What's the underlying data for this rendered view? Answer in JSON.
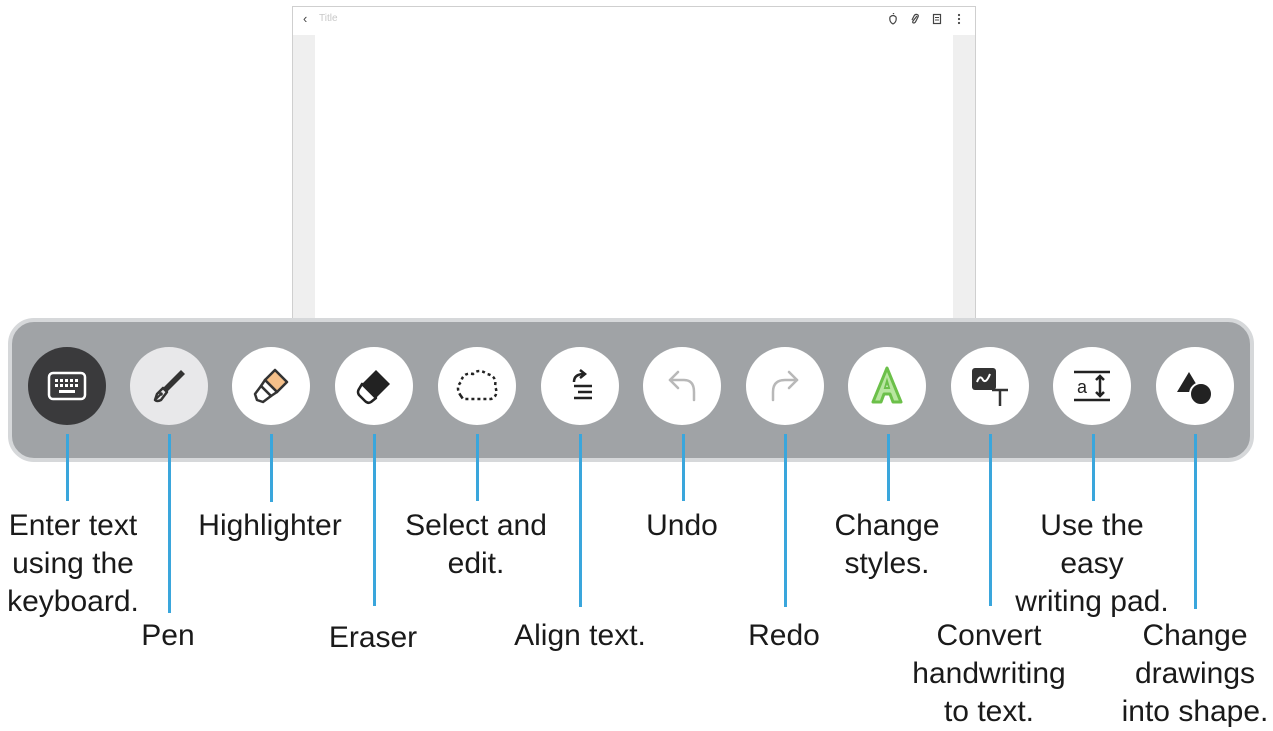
{
  "screen": {
    "title_placeholder": "Title",
    "back_glyph": "‹",
    "toolbar_icons": [
      "pdf-icon",
      "attach-icon",
      "file-icon",
      "more-icon"
    ]
  },
  "tools": [
    {
      "id": "keyboard",
      "icon": "keyboard-icon",
      "label": "Enter text\nusing the\nkeyboard."
    },
    {
      "id": "pen",
      "icon": "pen-icon",
      "label": "Pen"
    },
    {
      "id": "highlighter",
      "icon": "highlighter-icon",
      "label": "Highlighter"
    },
    {
      "id": "eraser",
      "icon": "eraser-icon",
      "label": "Eraser"
    },
    {
      "id": "select",
      "icon": "lasso-icon",
      "label": "Select and\nedit."
    },
    {
      "id": "align",
      "icon": "align-text-icon",
      "label": "Align text."
    },
    {
      "id": "undo",
      "icon": "undo-icon",
      "label": "Undo"
    },
    {
      "id": "redo",
      "icon": "redo-icon",
      "label": "Redo"
    },
    {
      "id": "styles",
      "icon": "style-icon",
      "label": "Change\nstyles."
    },
    {
      "id": "convert",
      "icon": "handwriting-to-text-icon",
      "label": "Convert\nhandwriting\nto text."
    },
    {
      "id": "writing-pad",
      "icon": "writing-pad-icon",
      "label": "Use the easy\nwriting pad."
    },
    {
      "id": "shapes",
      "icon": "shapes-icon",
      "label": "Change\ndrawings\ninto shape."
    }
  ],
  "colors": {
    "toolbar_bg": "#a0a3a6",
    "toolbar_border": "#d6d8da",
    "leader_line": "#3aa6dc",
    "highlighter_tip": "#f5c08a",
    "style_green": "#6cc04a"
  }
}
